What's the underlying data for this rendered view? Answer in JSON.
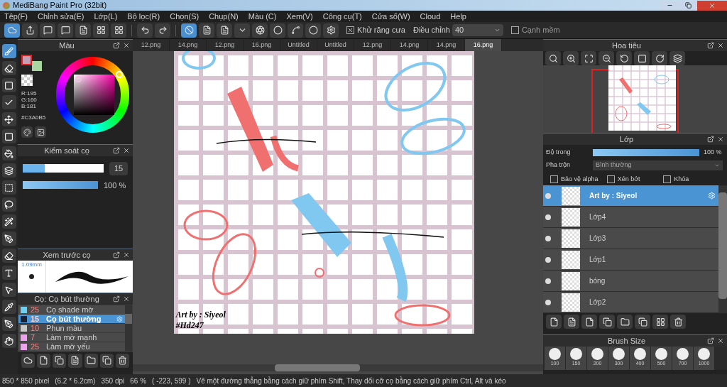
{
  "window": {
    "title": "MediBang Paint Pro (32bit)"
  },
  "menu": [
    "Tệp(F)",
    "Chỉnh sửa(E)",
    "Lớp(L)",
    "Bộ lọc(R)",
    "Chọn(S)",
    "Chụp(N)",
    "Màu (C)",
    "Xem(V)",
    "Công cụ(T)",
    "Cửa sổ(W)",
    "Cloud",
    "Help"
  ],
  "toolbar": {
    "antialias": {
      "label": "Khử răng cưa",
      "checked": true
    },
    "adjust": {
      "label": "Điều chỉnh",
      "value": "40"
    },
    "soft_edge": {
      "label": "Cạnh mềm",
      "checked": false
    }
  },
  "tabs": [
    {
      "label": "12.png",
      "selected": false
    },
    {
      "label": "14.png",
      "selected": false
    },
    {
      "label": "12.png",
      "selected": false
    },
    {
      "label": "16.png",
      "selected": false
    },
    {
      "label": "Untitled",
      "selected": false
    },
    {
      "label": "Untitled",
      "selected": false
    },
    {
      "label": "12.png",
      "selected": false
    },
    {
      "label": "14.png",
      "selected": false
    },
    {
      "label": "14.png",
      "selected": false
    },
    {
      "label": "16.png",
      "selected": true
    }
  ],
  "color_panel": {
    "title": "Màu",
    "swatches": [
      {
        "color": "#c3a0b5"
      },
      {
        "color": "#a8d8a0"
      }
    ],
    "r": "R:195",
    "g": "G:160",
    "b": "B:181",
    "hex": "#C3A0B5"
  },
  "brush_control": {
    "title": "Kiểm soát cọ",
    "size_slider": {
      "level": 0.27
    },
    "size": "15",
    "opacity_slider": {
      "level": 1
    },
    "opacity": "100 %"
  },
  "brush_preview": {
    "title": "Xem trước cọ",
    "size": "1.09mm"
  },
  "brush_list": {
    "title": "Cọ: Cọ bút thường",
    "items": [
      {
        "color": "#6cd0f0",
        "size": "25",
        "name": "Cọ shade mờ",
        "selected": false
      },
      {
        "color": "#1a2030",
        "size": "15",
        "name": "Cọ bút thường",
        "selected": true
      },
      {
        "color": "#c8c8c8",
        "size": "10",
        "name": "Phun màu",
        "selected": false
      },
      {
        "color": "#f0a0f0",
        "size": "7",
        "name": "Làm mờ mạnh",
        "selected": false
      },
      {
        "color": "#f0a0f0",
        "size": "25",
        "name": "Làm mờ yếu",
        "selected": false
      }
    ]
  },
  "canvas": {
    "credit": "Art by : Siyeol",
    "tag": "#Hd247"
  },
  "navigator": {
    "title": "Hoa tiêu"
  },
  "layers": {
    "title": "Lớp",
    "opacity_label": "Độ trong",
    "opacity_slider": {
      "level": 1
    },
    "opacity": "100 %",
    "blend_label": "Pha trộn",
    "blend": "Bình thường",
    "options": [
      {
        "label": "Bảo vệ alpha",
        "checked": false
      },
      {
        "label": "Xén bớt",
        "checked": false
      },
      {
        "label": "Khóa",
        "checked": false
      }
    ],
    "items": [
      {
        "name": "Art by : Siyeol",
        "selected": true
      },
      {
        "name": "Lớp4",
        "selected": false
      },
      {
        "name": "Lớp3",
        "selected": false
      },
      {
        "name": "Lớp1",
        "selected": false
      },
      {
        "name": "bóng",
        "selected": false
      },
      {
        "name": "Lớp2",
        "selected": false
      }
    ]
  },
  "brush_size": {
    "title": "Brush Size",
    "sizes": [
      "100",
      "150",
      "200",
      "300",
      "400",
      "500",
      "700",
      "1000"
    ]
  },
  "status_bar": [
    "850 * 850 pixel",
    "(6.2 * 6.2cm)",
    "350 dpi",
    "66 %",
    "( -223, 599 )",
    "Vẽ một đường thẳng bằng cách giữ phím Shift, Thay đổi cỡ cọ bằng cách giữ phím Ctrl, Alt và kéo"
  ]
}
